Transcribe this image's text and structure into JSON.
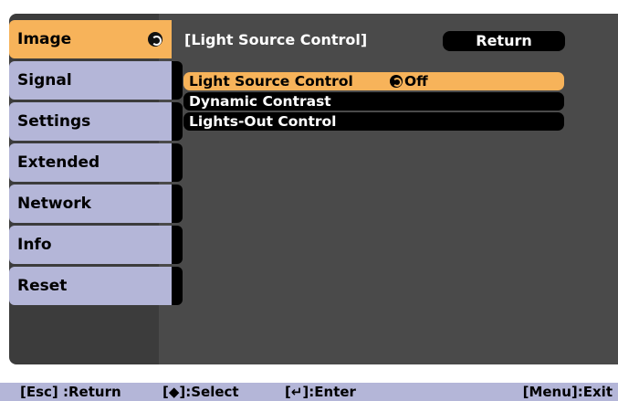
{
  "sidebar": {
    "items": [
      {
        "label": "Image",
        "active": true
      },
      {
        "label": "Signal",
        "active": false
      },
      {
        "label": "Settings",
        "active": false
      },
      {
        "label": "Extended",
        "active": false
      },
      {
        "label": "Network",
        "active": false
      },
      {
        "label": "Info",
        "active": false
      },
      {
        "label": "Reset",
        "active": false
      }
    ]
  },
  "panel": {
    "title": "[Light Source Control]",
    "return_label": "Return",
    "options": [
      {
        "label": "Light Source Control",
        "value": "Off",
        "selected": true
      },
      {
        "label": "Dynamic Contrast",
        "value": "",
        "selected": false
      },
      {
        "label": "Lights-Out Control",
        "value": "",
        "selected": false
      }
    ]
  },
  "footer": {
    "esc": "[Esc] :Return",
    "select": "[◆]:Select",
    "enter": "[↵]:Enter",
    "menu": "[Menu]:Exit"
  },
  "colors": {
    "accent": "#f7b35a",
    "tab": "#b4b6d8",
    "panel_bg": "#4a4a4a"
  }
}
